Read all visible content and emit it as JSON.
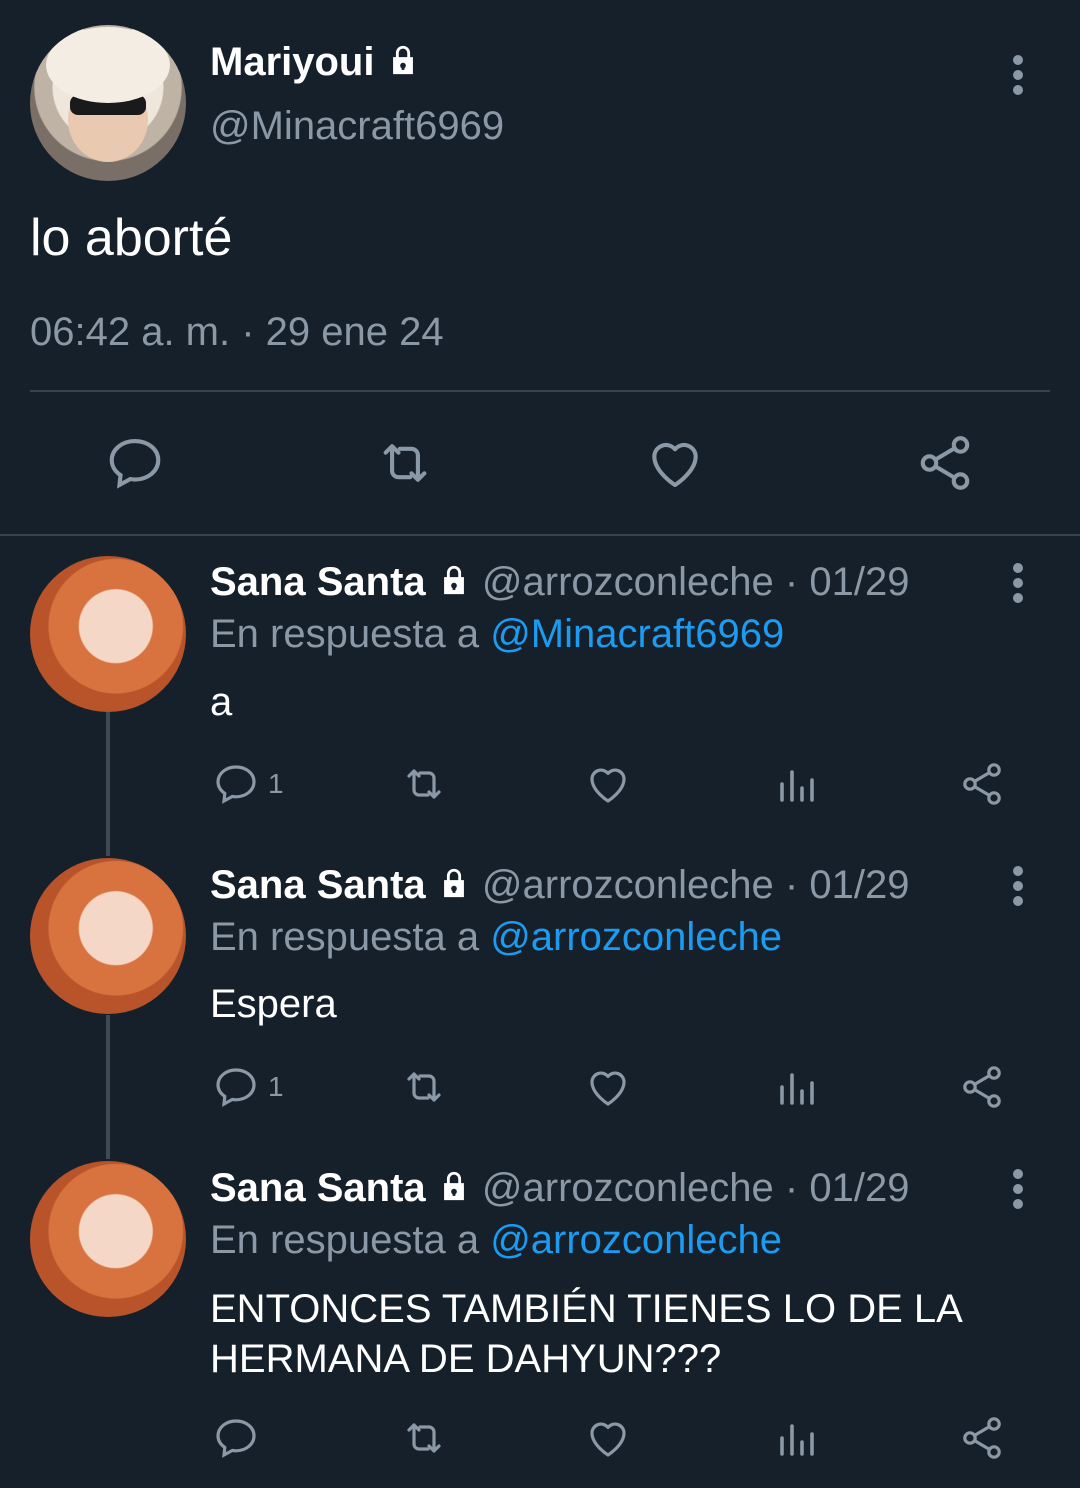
{
  "main_tweet": {
    "display_name": "Mariyoui",
    "handle": "@Minacraft6969",
    "text": "lo aborté",
    "timestamp": "06:42 a. m. · 29 ene 24"
  },
  "replies": [
    {
      "display_name": "Sana Santa",
      "handle": "@arrozconleche",
      "date": "01/29",
      "reply_prefix": "En respuesta a",
      "reply_to": "@Minacraft6969",
      "text": "a",
      "reply_count": "1"
    },
    {
      "display_name": "Sana Santa",
      "handle": "@arrozconleche",
      "date": "01/29",
      "reply_prefix": "En respuesta a",
      "reply_to": "@arrozconleche",
      "text": "Espera",
      "reply_count": "1"
    },
    {
      "display_name": "Sana Santa",
      "handle": "@arrozconleche",
      "date": "01/29",
      "reply_prefix": "En respuesta a",
      "reply_to": "@arrozconleche",
      "text": "ENTONCES TAMBIÉN TIENES LO DE LA HERMANA DE DAHYUN???",
      "reply_count": ""
    }
  ],
  "colors": {
    "background": "#15202b",
    "muted_text": "#8b98a5",
    "link": "#1d9bf0",
    "divider": "#38444d"
  },
  "icons": [
    "lock-icon",
    "more-icon",
    "reply-icon",
    "retweet-icon",
    "like-icon",
    "share-icon",
    "views-icon"
  ]
}
